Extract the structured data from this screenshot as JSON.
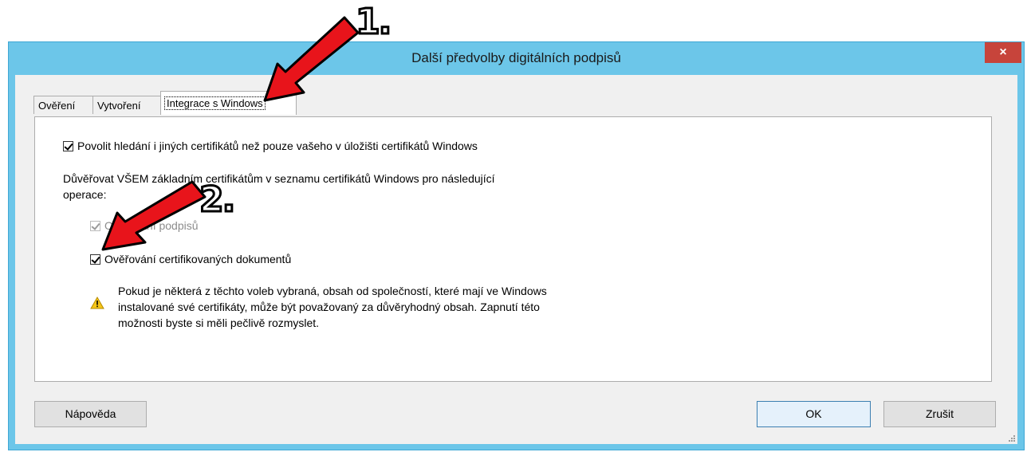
{
  "window": {
    "title": "Další předvolby digitálních podpisů",
    "close_label": "×"
  },
  "tabs": [
    {
      "label": "Ověření"
    },
    {
      "label": "Vytvoření"
    },
    {
      "label": "Integrace s Windows"
    }
  ],
  "panel": {
    "search_checkbox_label": "Povolit hledání i jiných certifikátů než pouze vašeho v úložišti certifikátů Windows",
    "trust_text_line1": "Důvěřovat VŠEM základním certifikátům v seznamu certifikátů Windows pro následující",
    "trust_text_line2": "operace:",
    "validate_signatures_label": "Ověřování podpisů",
    "validate_certified_label": "Ověřování certifikovaných dokumentů",
    "warning_line1": "Pokud je některá z těchto voleb vybraná, obsah od společností, které mají ve Windows",
    "warning_line2": "instalované své certifikáty, může být považovaný za důvěryhodný obsah. Zapnutí této",
    "warning_line3": "možnosti byste si měli pečlivě rozmyslet."
  },
  "buttons": {
    "help": "Nápověda",
    "ok": "OK",
    "cancel": "Zrušit"
  },
  "annotations": {
    "step1": "1.",
    "step2": "2."
  },
  "colors": {
    "titlebar": "#6cc6e9",
    "close": "#c7443b",
    "arrow": "#e8141b"
  }
}
